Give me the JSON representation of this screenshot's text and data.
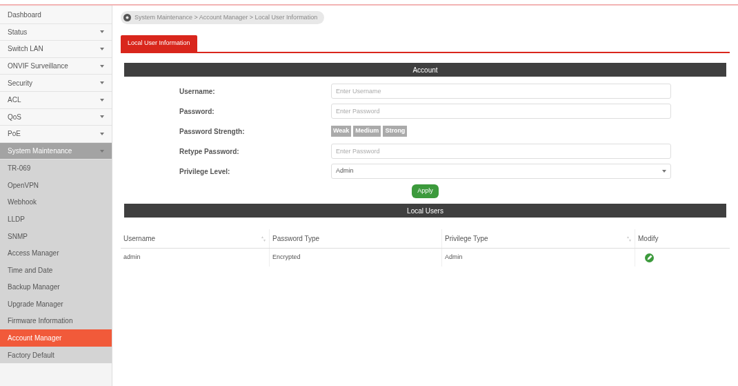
{
  "sidebar": {
    "items": [
      {
        "label": "Dashboard",
        "expandable": false,
        "expanded": false,
        "selected": false
      },
      {
        "label": "Status",
        "expandable": true,
        "expanded": false,
        "selected": false
      },
      {
        "label": "Switch LAN",
        "expandable": true,
        "expanded": false,
        "selected": false
      },
      {
        "label": "ONVIF Surveillance",
        "expandable": true,
        "expanded": false,
        "selected": false
      },
      {
        "label": "Security",
        "expandable": true,
        "expanded": false,
        "selected": false
      },
      {
        "label": "ACL",
        "expandable": true,
        "expanded": false,
        "selected": false
      },
      {
        "label": "QoS",
        "expandable": true,
        "expanded": false,
        "selected": false
      },
      {
        "label": "PoE",
        "expandable": true,
        "expanded": false,
        "selected": false
      },
      {
        "label": "System Maintenance",
        "expandable": true,
        "expanded": true,
        "selected": false,
        "children": [
          {
            "label": "TR-069",
            "selected": false
          },
          {
            "label": "OpenVPN",
            "selected": false
          },
          {
            "label": "Webhook",
            "selected": false
          },
          {
            "label": "LLDP",
            "selected": false
          },
          {
            "label": "SNMP",
            "selected": false
          },
          {
            "label": "Access Manager",
            "selected": false
          },
          {
            "label": "Time and Date",
            "selected": false
          },
          {
            "label": "Backup Manager",
            "selected": false
          },
          {
            "label": "Upgrade Manager",
            "selected": false
          },
          {
            "label": "Firmware Information",
            "selected": false
          },
          {
            "label": "Account Manager",
            "selected": true
          },
          {
            "label": "Factory Default",
            "selected": false
          }
        ]
      }
    ]
  },
  "breadcrumb": "System Maintenance > Account Manager > Local User Information",
  "tabs": [
    {
      "label": "Local User Information",
      "selected": true
    }
  ],
  "account": {
    "title": "Account",
    "fields": [
      {
        "kind": "input",
        "label": "Username:",
        "placeholder": "Enter Username"
      },
      {
        "kind": "input",
        "label": "Password:",
        "placeholder": "Enter Password"
      },
      {
        "kind": "strength",
        "label": "Password Strength:",
        "levels": [
          {
            "label": "Weak",
            "on": false
          },
          {
            "label": "Medium",
            "on": false
          },
          {
            "label": "Strong",
            "on": false
          }
        ]
      },
      {
        "kind": "input",
        "label": "Retype Password:",
        "placeholder": "Enter Password"
      },
      {
        "kind": "select",
        "label": "Privilege Level:",
        "value": "Admin"
      }
    ],
    "apply": "Apply"
  },
  "local_users": {
    "title": "Local Users",
    "columns": [
      {
        "label": "Username",
        "sortable": true
      },
      {
        "label": "Password Type",
        "sortable": false
      },
      {
        "label": "Privilege Type",
        "sortable": true
      },
      {
        "label": "Modify",
        "sortable": false
      }
    ],
    "rows": [
      {
        "username": "admin",
        "password_type": "Encrypted",
        "privilege_type": "Admin"
      }
    ]
  }
}
